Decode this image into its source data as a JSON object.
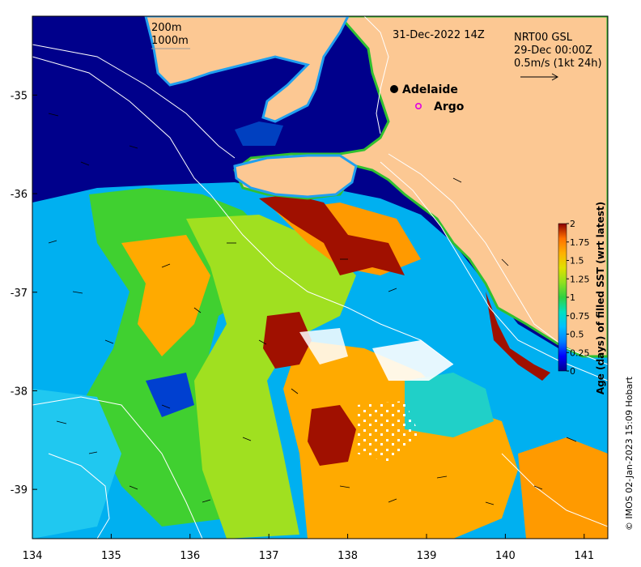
{
  "map": {
    "date_label": "31-Dec-2022 14Z",
    "product_line1": "NRT00 GSL",
    "product_line2": "29-Dec 00:00Z",
    "vector_scale_label": "0.5m/s (1kt 24h)",
    "isobath_labels": [
      "200m",
      "1000m"
    ],
    "places": [
      {
        "label": "Adelaide",
        "marker": "filled-dot",
        "color": "#000000"
      },
      {
        "label": "Argo",
        "marker": "open-circle",
        "color": "#e000e0"
      }
    ],
    "x_axis": {
      "ticks": [
        "134",
        "135",
        "136",
        "137",
        "138",
        "139",
        "140",
        "141"
      ],
      "range": [
        134,
        141.3
      ]
    },
    "y_axis": {
      "ticks": [
        "-35",
        "-36",
        "-37",
        "-38",
        "-39"
      ],
      "range": [
        -39.5,
        -34.2
      ]
    },
    "credit": "© IMOS 02-Jan-2023 15:09 Hobart"
  },
  "colorbar": {
    "title": "Age (days) of filled SST (wrt latest)",
    "ticks": [
      "2",
      "1.75",
      "1.5",
      "1.25",
      "1",
      "0.75",
      "0.5",
      "0.25",
      "0"
    ],
    "range": [
      0,
      2
    ],
    "colors": [
      "#00008b",
      "#0000ff",
      "#0080ff",
      "#00c0ff",
      "#00e0c0",
      "#30d040",
      "#90e020",
      "#e0e000",
      "#ffb000",
      "#ff7000",
      "#c03000",
      "#8b0000"
    ]
  },
  "colors": {
    "land": "#fcc893",
    "deep_ocean": "#00008b",
    "no_data": "#ffffff"
  }
}
